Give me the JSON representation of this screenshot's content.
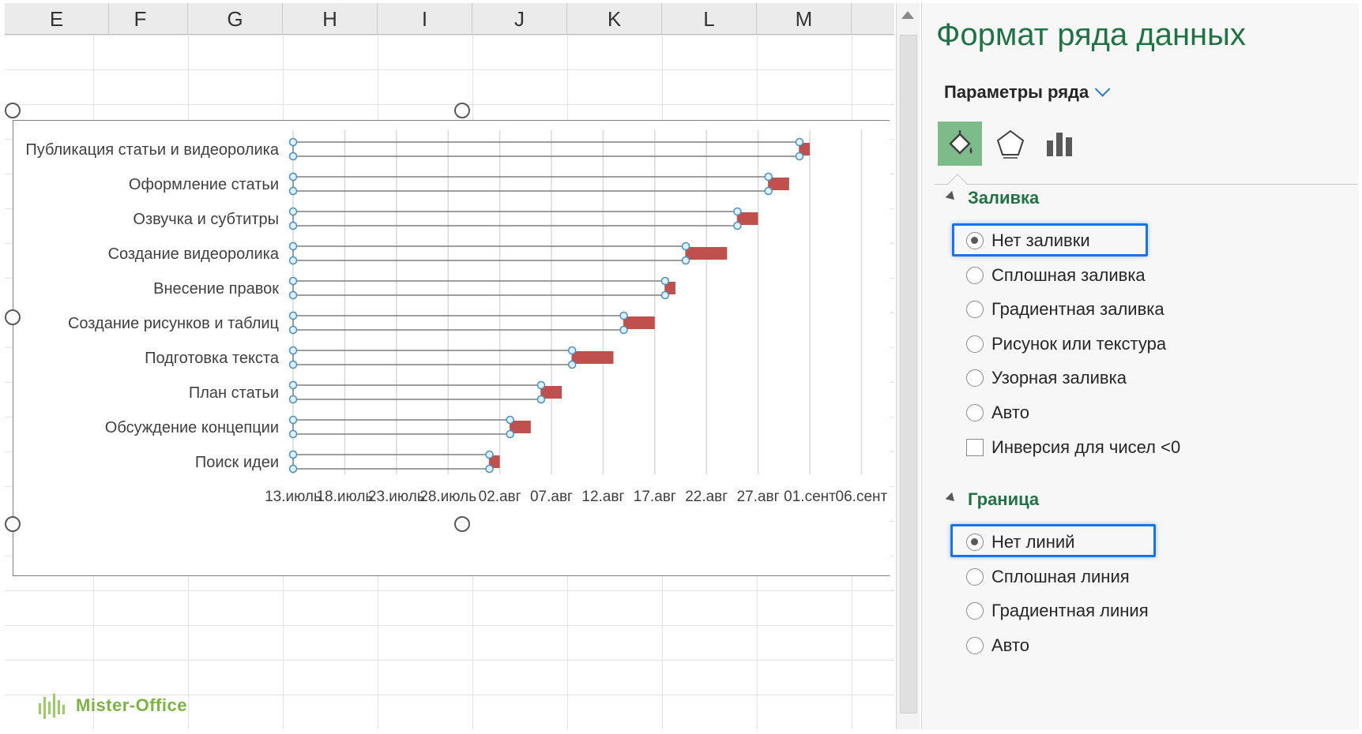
{
  "columns": [
    "E",
    "F",
    "G",
    "H",
    "I",
    "J",
    "K",
    "L",
    "M"
  ],
  "chart": {
    "tasks": [
      {
        "name": "Публикация статьи и видеоролика",
        "start": "2023-07-13",
        "end": "2023-08-31",
        "duration_days": 1
      },
      {
        "name": "Оформление статьи",
        "start": "2023-07-13",
        "end": "2023-08-28",
        "duration_days": 2
      },
      {
        "name": "Озвучка и субтитры",
        "start": "2023-07-13",
        "end": "2023-08-25",
        "duration_days": 2
      },
      {
        "name": "Создание видеоролика",
        "start": "2023-07-13",
        "end": "2023-08-20",
        "duration_days": 4
      },
      {
        "name": "Внесение правок",
        "start": "2023-07-13",
        "end": "2023-08-18",
        "duration_days": 1
      },
      {
        "name": "Создание рисунков и таблиц",
        "start": "2023-07-13",
        "end": "2023-08-14",
        "duration_days": 3
      },
      {
        "name": "Подготовка текста",
        "start": "2023-07-13",
        "end": "2023-08-09",
        "duration_days": 4
      },
      {
        "name": "План статьи",
        "start": "2023-07-13",
        "end": "2023-08-06",
        "duration_days": 2
      },
      {
        "name": "Обсуждение концепции",
        "start": "2023-07-13",
        "end": "2023-08-03",
        "duration_days": 2
      },
      {
        "name": "Поиск идеи",
        "start": "2023-07-13",
        "end": "2023-08-01",
        "duration_days": 1
      }
    ],
    "x_ticks": [
      "13.июль",
      "18.июль",
      "23.июль",
      "28.июль",
      "02.авг",
      "07.авг",
      "12.авг",
      "17.авг",
      "22.авг",
      "27.авг",
      "01.сент",
      "06.сент"
    ],
    "bar_color": "#c0504d"
  },
  "chart_data": {
    "type": "bar",
    "orientation": "horizontal",
    "categories": [
      "Публикация статьи и видеоролика",
      "Оформление статьи",
      "Озвучка и субтитры",
      "Создание видеоролика",
      "Внесение правок",
      "Создание рисунков и таблиц",
      "Подготовка текста",
      "План статьи",
      "Обсуждение концепции",
      "Поиск идеи"
    ],
    "x_tick_labels": [
      "13.июль",
      "18.июль",
      "23.июль",
      "28.июль",
      "02.авг",
      "07.авг",
      "12.авг",
      "17.авг",
      "22.авг",
      "27.авг",
      "01.сент",
      "06.сент"
    ],
    "xlim": [
      "2023-07-13",
      "2023-09-06"
    ],
    "grid": true,
    "legend": "none"
  },
  "logo": {
    "text": "Mister-Office"
  },
  "panel": {
    "title": "Формат ряда данных",
    "options_label": "Параметры ряда",
    "tabs": [
      {
        "icon": "paint-bucket-icon"
      },
      {
        "icon": "pentagon-icon"
      },
      {
        "icon": "bar-chart-icon"
      }
    ],
    "fill": {
      "label": "Заливка",
      "options": [
        "Нет заливки",
        "Сплошная заливка",
        "Градиентная заливка",
        "Рисунок или текстура",
        "Узорная заливка",
        "Авто"
      ],
      "selected": "Нет заливки",
      "invert_label": "Инверсия для чисел <0"
    },
    "border": {
      "label": "Граница",
      "options": [
        "Нет линий",
        "Сплошная линия",
        "Градиентная линия",
        "Авто"
      ],
      "selected": "Нет линий"
    }
  }
}
